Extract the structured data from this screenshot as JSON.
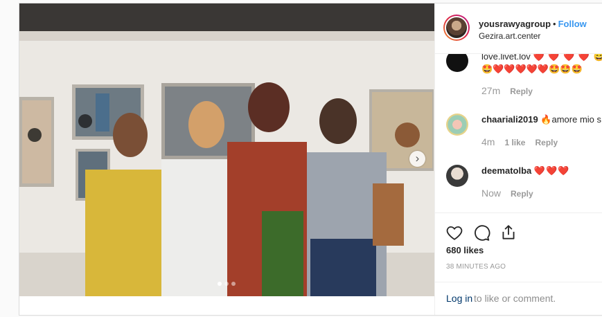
{
  "post": {
    "username": "yousrawyagroup",
    "separator": "•",
    "follow_label": "Follow",
    "location": "Gezira.art.center",
    "next_icon": "›",
    "carousel": {
      "count": 3,
      "active": 0
    }
  },
  "comments": [
    {
      "username": "",
      "text": "love.livet.lov",
      "emoji_line1": "❤️ ❤️ ❤️ ❤️ 😄",
      "emoji_line2": "🤩❤️❤️❤️❤️❤️🤩🤩🤩",
      "time": "27m",
      "likes": "",
      "reply": "Reply"
    },
    {
      "username": "chaariali2019",
      "text": "🔥amore mio s",
      "time": "4m",
      "likes": "1 like",
      "reply": "Reply"
    },
    {
      "username": "deematolba",
      "text": "❤️❤️❤️",
      "time": "Now",
      "likes": "",
      "reply": "Reply"
    }
  ],
  "actions": {
    "like_icon": "heart-icon",
    "comment_icon": "comment-icon",
    "share_icon": "share-icon",
    "likes": "680 likes",
    "timestamp": "38 MINUTES AGO"
  },
  "login": {
    "link": "Log in",
    "rest": "to like or comment."
  },
  "colors": {
    "accent": "#3897f0",
    "heart": "#ed4956",
    "text": "#262626",
    "muted": "#999999"
  }
}
